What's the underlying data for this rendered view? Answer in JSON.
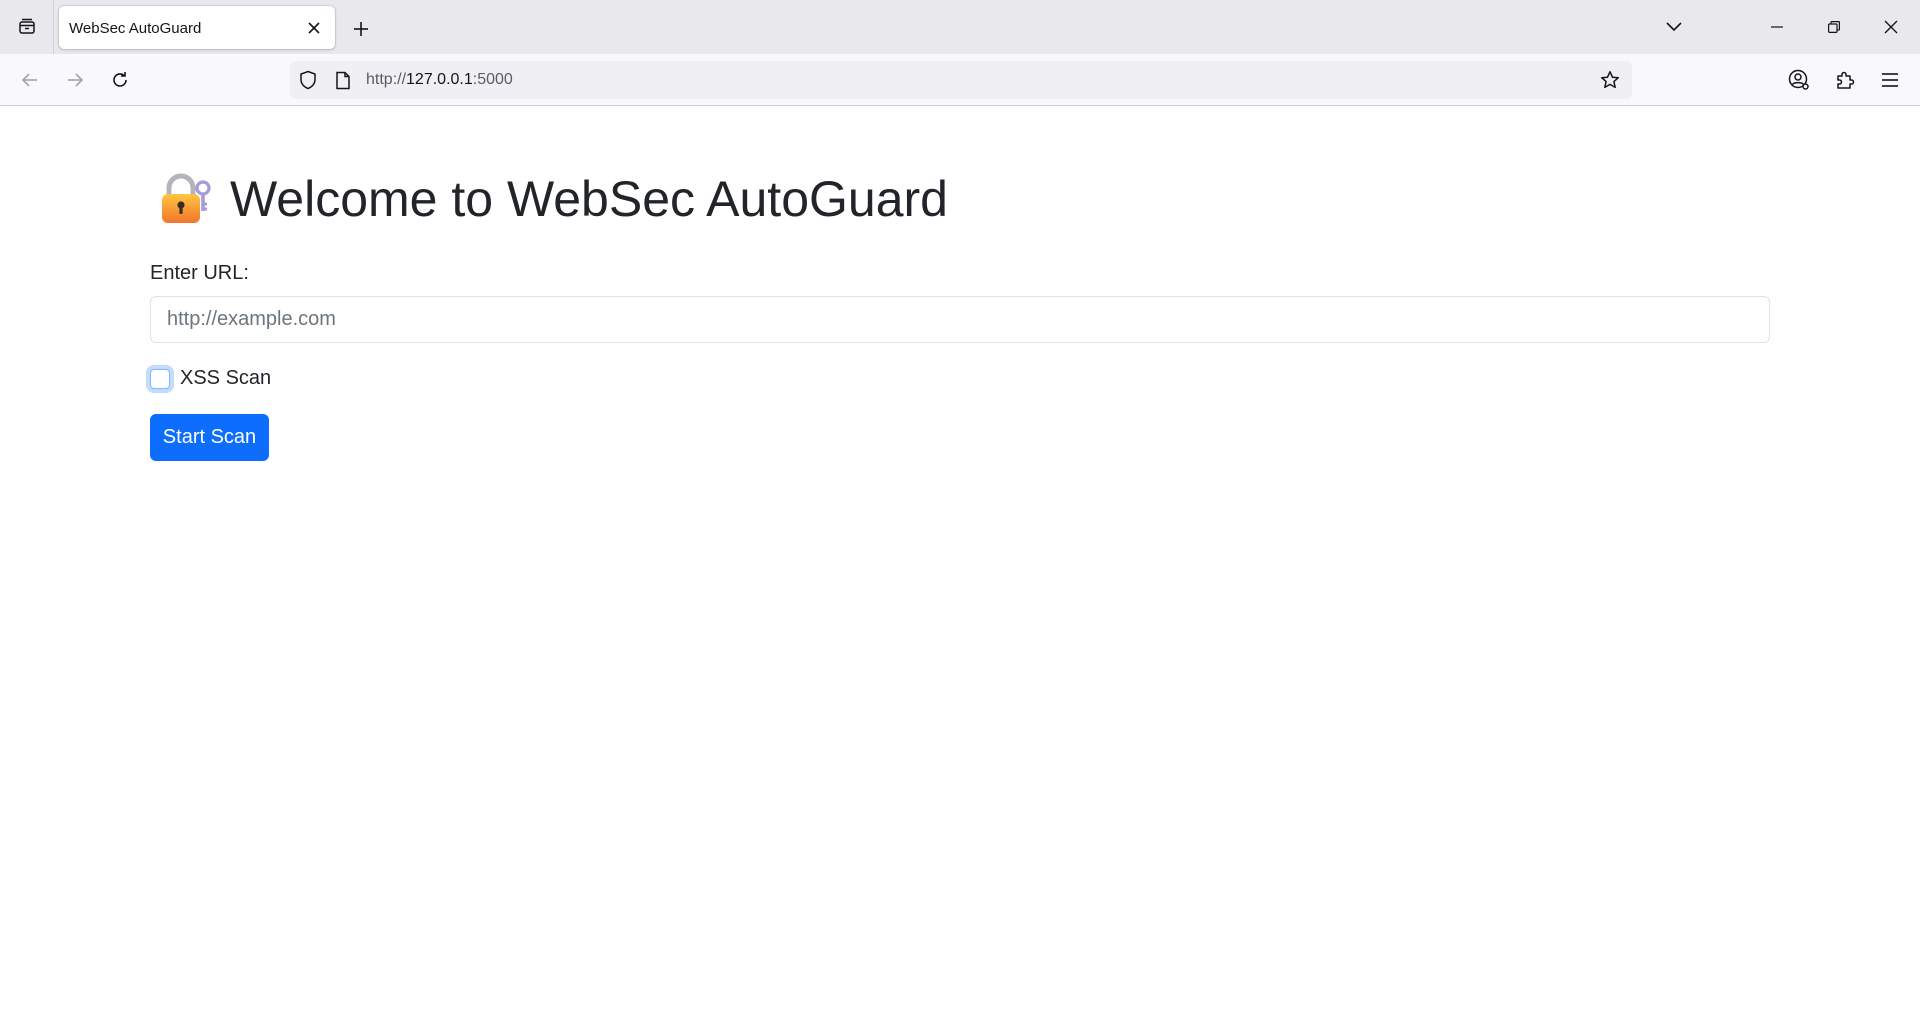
{
  "browser": {
    "tab": {
      "title": "WebSec AutoGuard"
    },
    "address": {
      "prefix": "http://",
      "host": "127.0.0.1",
      "port": ":5000"
    },
    "icons": {
      "tab_list": "tab-list-icon",
      "close_tab": "close-icon",
      "new_tab": "plus-icon",
      "back": "arrow-left-icon",
      "forward": "arrow-right-icon",
      "reload": "reload-icon",
      "shield": "shield-icon",
      "page": "page-icon",
      "bookmark": "star-icon",
      "account": "account-icon",
      "extensions": "puzzle-icon",
      "menu": "hamburger-menu-icon",
      "list_all_tabs": "chevron-down-icon",
      "minimize": "minimize-icon",
      "restore": "restore-icon",
      "close_window": "close-icon"
    }
  },
  "page": {
    "heading": "Welcome to WebSec AutoGuard",
    "heading_icon": "lock-with-key-icon",
    "url_label": "Enter URL:",
    "url_input": {
      "placeholder": "http://example.com",
      "value": ""
    },
    "xss_scan": {
      "label": "XSS Scan",
      "checked": false
    },
    "start_button": "Start Scan"
  },
  "colors": {
    "primary": "#0d6efd",
    "text": "#212529",
    "placeholder": "#6c757d",
    "chrome_bg": "#e8e8ed",
    "toolbar_bg": "#f9f9fb"
  }
}
